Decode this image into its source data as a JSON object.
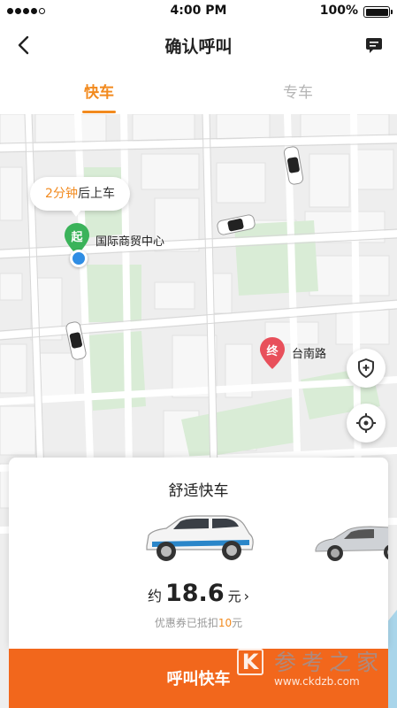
{
  "status_bar": {
    "time": "4:00 PM",
    "battery": "100%"
  },
  "nav": {
    "title": "确认呼叫",
    "back_icon": "back-arrow-icon",
    "message_icon": "message-icon"
  },
  "tabs": [
    {
      "label": "快车",
      "active": true
    },
    {
      "label": "专车",
      "active": false
    }
  ],
  "map": {
    "eta_bubble": {
      "highlight": "2分钟",
      "text": "后上车"
    },
    "start": {
      "marker": "起",
      "label": "国际商贸中心"
    },
    "end": {
      "marker": "终",
      "label": "台南路"
    },
    "safety_icon": "shield-plus-icon",
    "locate_icon": "locate-target-icon"
  },
  "card": {
    "title": "舒适快车",
    "price_prefix": "约",
    "price": "18.6",
    "price_unit": "元",
    "price_chevron": "›",
    "coupon_text": "优惠券已抵扣",
    "coupon_amount": "10",
    "coupon_unit": "元"
  },
  "call_button": {
    "label": "呼叫快车"
  },
  "watermark": {
    "logo": "K",
    "text": "参考之家",
    "url": "www.ckdzb.com"
  },
  "colors": {
    "accent": "#f28a1e",
    "call_button": "#f2671c",
    "start_pin": "#3bb35a",
    "end_pin": "#e8505b",
    "location": "#2f8de4"
  }
}
